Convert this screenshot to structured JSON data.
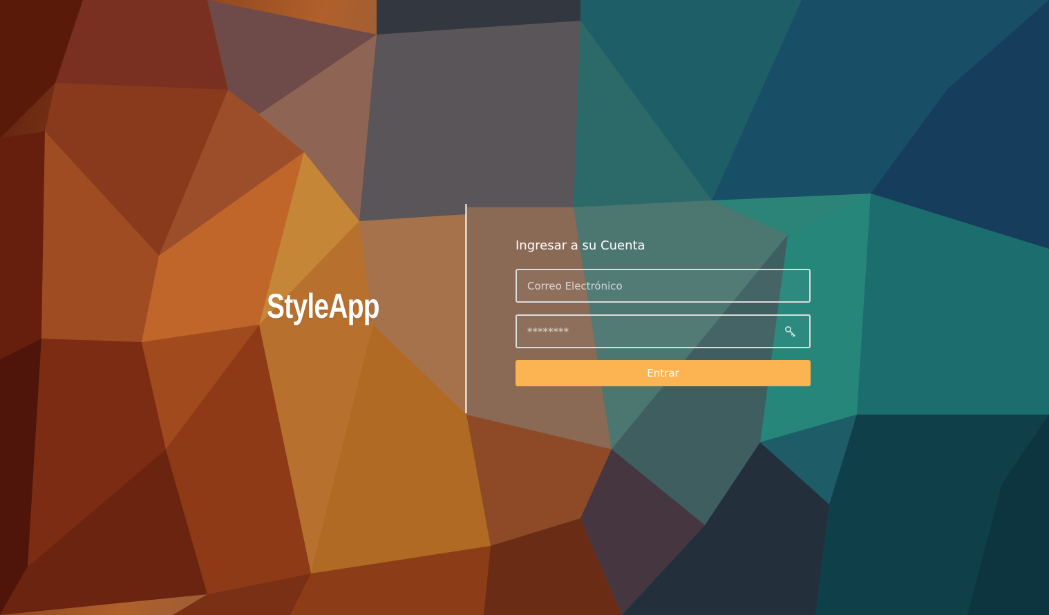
{
  "brand": {
    "name": "StyleApp"
  },
  "login": {
    "title": "Ingresar a su Cuenta",
    "email_placeholder": "Correo Electrónico",
    "password_placeholder": "********",
    "password_icon": "key-icon",
    "submit_label": "Entrar"
  },
  "colors": {
    "accent": "#fbb451",
    "field_border": "#dcdcdc"
  }
}
